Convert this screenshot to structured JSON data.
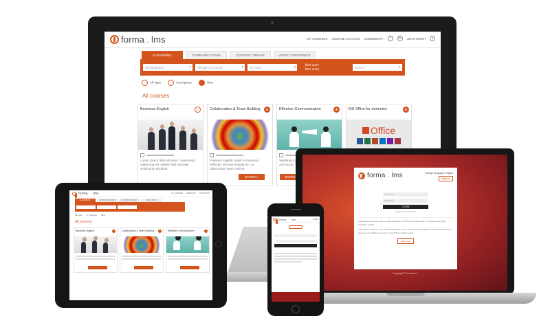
{
  "brand": {
    "name_a": "forma",
    "name_b": "lms",
    "accent": "#d4541e",
    "dark_red": "#9b1c1c"
  },
  "desktop": {
    "topnav": {
      "my_courses": "MY COURSES",
      "catalog": "COURSE CATALOG",
      "community": "COMMUNITY",
      "user": "JOHN SMITH",
      "help_icon": "help-icon",
      "settings_icon": "gear-icon",
      "user_icon": "user-icon"
    },
    "tabs": [
      "E-LEARNING",
      "COMMUNICATIONS",
      "CONTENT LIBRARY",
      "VIDEO CONFERENCE"
    ],
    "filters": {
      "categories": "All categories",
      "course_types": "All types of course",
      "years": "All years",
      "side_a": "filter open",
      "side_b": "filter reset",
      "search_placeholder": "Search"
    },
    "status": {
      "open": "All open",
      "in_progress": "In progress",
      "new": "New"
    },
    "heading": "All courses",
    "cards": [
      {
        "title": "Business English",
        "author": "",
        "desc": "Lorem ipsum dolor sit amet, consectetur adipiscing elit. Nullam sed nisi vitae vestibulum tincidunt.",
        "button": "ENTER"
      },
      {
        "title": "Collaboration & Team Building",
        "author": "",
        "desc": "Praesent sagittis, turpis et maximus vehicula, elit enim feugiat leo, at ullamcorper lorem velit at.",
        "button": "ENTER »"
      },
      {
        "title": "Effective Communication",
        "author": "",
        "desc": "Vestibulum ante ipsum primis in faucibus orci luctus.",
        "button": "ENTER"
      },
      {
        "title": "MS Office for dummies",
        "author": "",
        "desc": "",
        "button": "ENTER"
      }
    ],
    "office_word": "Office"
  },
  "laptop": {
    "lang_label": "Change language: English",
    "register": "Register",
    "username_placeholder": "Username",
    "password_placeholder": "Password",
    "login": "LOGIN",
    "forgot": "Forgot? Lost password",
    "intro": "FormaLms is an open source e-learning platform (LMS and LCMS) used in corporate and higher education market.",
    "intro2": "The platform supports more than 30 languages and is compliant with SCORM 1.2 and 2004 standards, giving you the ability to import any SCORM compliant course.",
    "read_more": "Read more",
    "copyright": "Copyright © FormaLms"
  },
  "tablet": {
    "tabs": [
      "E-LEARNING",
      "COMMUNICATIONS",
      "CONTENT LIBRARY",
      "VIDEO CONF"
    ],
    "status": {
      "open": "All open",
      "in_progress": "In progress",
      "new": "New"
    },
    "heading": "All courses",
    "cards": [
      {
        "title": "Business English"
      },
      {
        "title": "Collaboration & Team Building"
      },
      {
        "title": "Effective Communication"
      }
    ]
  },
  "phone": {
    "lang": "English"
  }
}
